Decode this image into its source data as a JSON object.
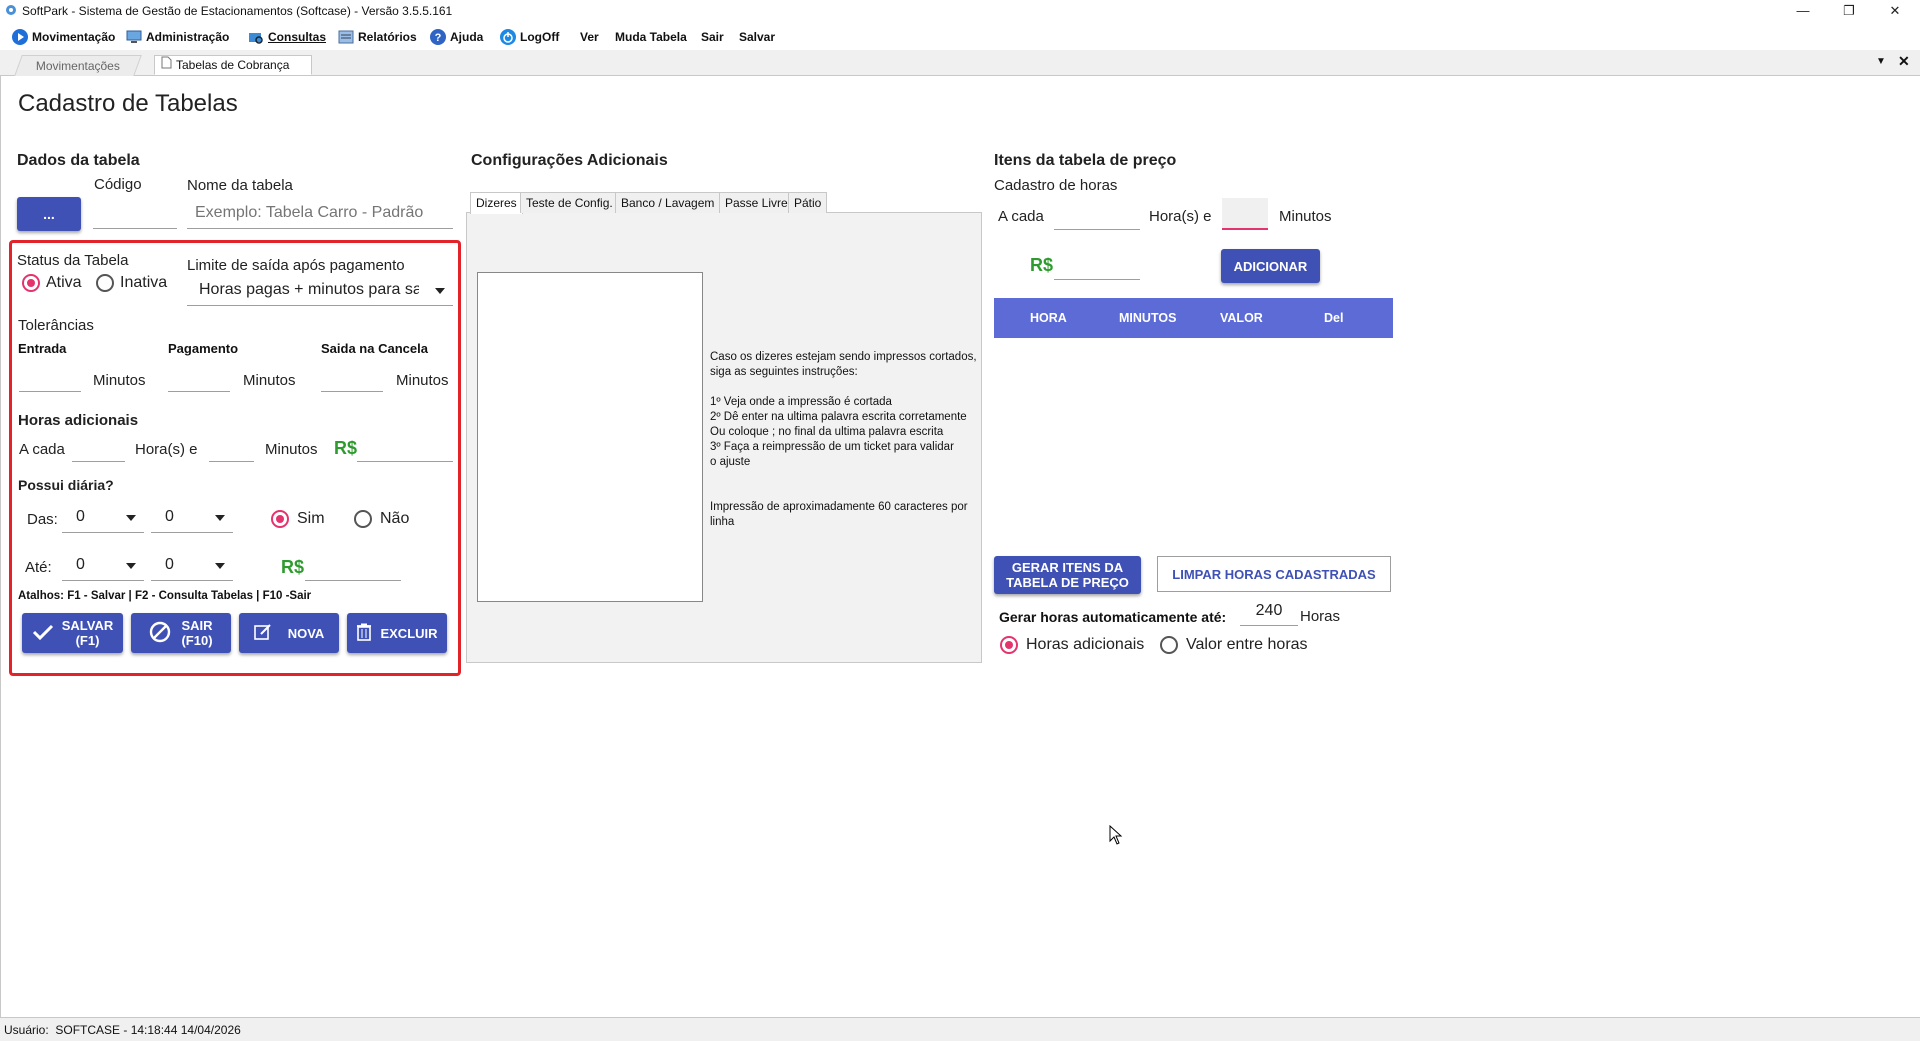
{
  "window": {
    "title": "SoftPark - Sistema de Gestão de Estacionamentos (Softcase) - Versão 3.5.5.161",
    "minimize_glyph": "—",
    "restore_glyph": "❐",
    "close_glyph": "✕"
  },
  "menu": {
    "items": [
      {
        "label": "Movimentação",
        "icon": "play-circle-icon"
      },
      {
        "label": "Administração",
        "icon": "monitor-icon"
      },
      {
        "label": "Consultas",
        "icon": "folder-search-icon"
      },
      {
        "label": "Relatórios",
        "icon": "report-icon"
      },
      {
        "label": "Ajuda",
        "icon": "help-icon"
      },
      {
        "label": "LogOff",
        "icon": "power-icon"
      },
      {
        "label": "Ver"
      },
      {
        "label": "Muda Tabela"
      },
      {
        "label": "Sair"
      },
      {
        "label": "Salvar"
      }
    ]
  },
  "tabs": {
    "items": [
      "Movimentações",
      "Tabelas de Cobrança"
    ],
    "active": "Tabelas de Cobrança",
    "dropdown_glyph": "▼",
    "close_glyph": "✕"
  },
  "page": {
    "title": "Cadastro de Tabelas"
  },
  "dados": {
    "section_title": "Dados da tabela",
    "lookup_button": "...",
    "codigo_label": "Código",
    "codigo_value": "",
    "nome_label": "Nome da tabela",
    "nome_placeholder": "Exemplo: Tabela Carro - Padrão",
    "status_label": "Status da Tabela",
    "status_ativa": "Ativa",
    "status_inativa": "Inativa",
    "limite_label": "Limite de saída após pagamento",
    "limite_value": "Horas pagas + minutos para saída",
    "tolerancias_label": "Tolerâncias",
    "entrada_label": "Entrada",
    "pagamento_label": "Pagamento",
    "saida_cancela_label": "Saida na Cancela",
    "minutos": "Minutos",
    "horas_adicionais_label": "Horas adicionais",
    "a_cada": "A cada",
    "horas_e": "Hora(s) e",
    "rs": "R$",
    "possui_diaria_label": "Possui diária?",
    "das_label": "Das:",
    "ate_label": "Até:",
    "das_h": "0",
    "das_m": "0",
    "ate_h": "0",
    "ate_m": "0",
    "sim": "Sim",
    "nao": "Não",
    "atalhos": "Atalhos: F1 - Salvar | F2 - Consulta Tabelas | F10 -Sair",
    "btn_salvar_1": "SALVAR",
    "btn_salvar_2": "(F1)",
    "btn_sair_1": "SAIR",
    "btn_sair_2": "(F10)",
    "btn_nova": "NOVA",
    "btn_excluir": "EXCLUIR"
  },
  "config": {
    "section_title": "Configurações Adicionais",
    "tabs": [
      "Dizeres",
      "Teste de Config.",
      "Banco / Lavagem",
      "Passe Livre",
      "Pátio"
    ],
    "active_tab": "Dizeres",
    "note_lines": [
      "Caso os dizeres estejam sendo impressos cortados,",
      "siga as seguintes instruções:",
      "",
      "1º Veja onde a impressão é cortada",
      "2º Dê enter na ultima palavra escrita corretamente",
      "Ou coloque ; no final da ultima palavra escrita",
      "3º Faça a reimpressão de um ticket para validar",
      "o ajuste",
      "",
      "",
      "Impressão de aproximadamente 60 caracteres por",
      "linha"
    ]
  },
  "itens": {
    "section_title": "Itens da tabela de preço",
    "cadastro_horas": "Cadastro de horas",
    "a_cada": "A cada",
    "horas_e": "Hora(s) e",
    "minutos": "Minutos",
    "rs": "R$",
    "btn_adicionar": "ADICIONAR",
    "columns": [
      "HORA",
      "MINUTOS",
      "VALOR",
      "Del"
    ],
    "btn_gerar_1": "GERAR ITENS DA",
    "btn_gerar_2": "TABELA DE PREÇO",
    "btn_limpar": "LIMPAR HORAS CADASTRADAS",
    "gerar_auto_label": "Gerar horas automaticamente até:",
    "gerar_auto_value": "240",
    "horas": "Horas",
    "opt_horas_adicionais": "Horas adicionais",
    "opt_valor_entre": "Valor entre horas"
  },
  "status_bar": {
    "text": "Usuário:  SOFTCASE - 14:18:44 14/04/2026"
  },
  "colors": {
    "primary": "#3f51b5",
    "header": "#5c6bd6",
    "accent": "#e5336e",
    "money": "#2e9b2e",
    "highlight": "#e2232a"
  }
}
